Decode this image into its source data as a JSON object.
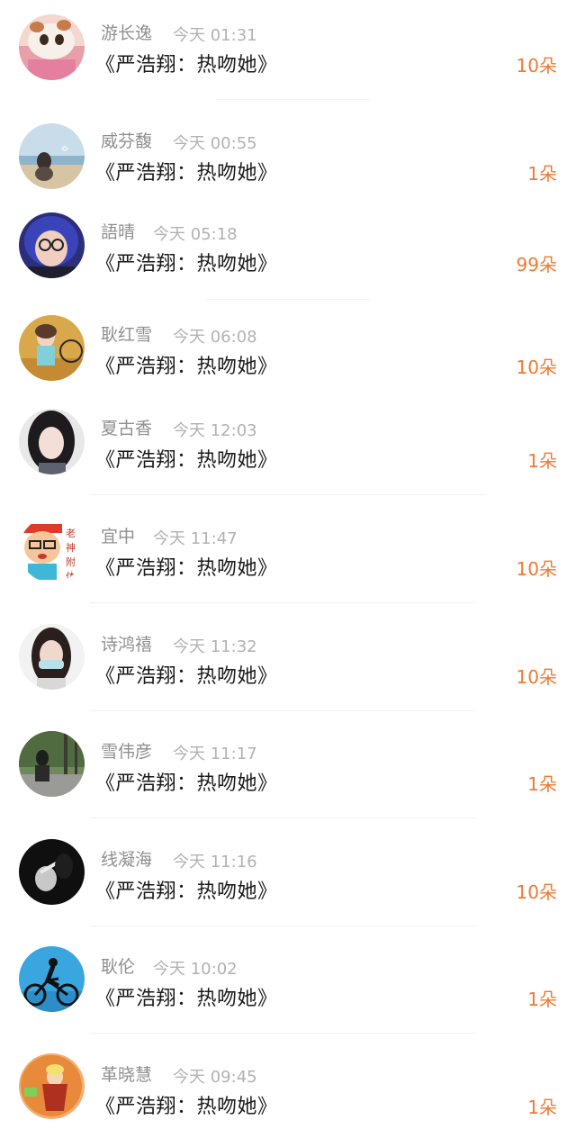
{
  "accent_color": "#f07a33",
  "items": [
    {
      "username": "游长逸",
      "time": "今天 01:31",
      "title": "《严浩翔：热吻她》",
      "count": "10朵",
      "avatar_icon": "cat-avatar-icon"
    },
    {
      "username": "威芬馥",
      "time": "今天 00:55",
      "title": "《严浩翔：热吻她》",
      "count": "1朵",
      "avatar_icon": "beach-avatar-icon"
    },
    {
      "username": "語晴",
      "time": "今天 05:18",
      "title": "《严浩翔：热吻她》",
      "count": "99朵",
      "avatar_icon": "glasses-girl-avatar-icon"
    },
    {
      "username": "耿红雪",
      "time": "今天 06:08",
      "title": "《严浩翔：热吻她》",
      "count": "10朵",
      "avatar_icon": "autumn-girl-avatar-icon"
    },
    {
      "username": "夏古香",
      "time": "今天 12:03",
      "title": "《严浩翔：热吻她》",
      "count": "1朵",
      "avatar_icon": "portrait-girl-avatar-icon"
    },
    {
      "username": "宜中",
      "time": "今天 11:47",
      "title": "《严浩翔：热吻她》",
      "count": "10朵",
      "avatar_icon": "cartoon-avatar-icon"
    },
    {
      "username": "诗鸿禧",
      "time": "今天 11:32",
      "title": "《严浩翔：热吻她》",
      "count": "10朵",
      "avatar_icon": "mask-girl-avatar-icon"
    },
    {
      "username": "雪伟彦",
      "time": "今天 11:17",
      "title": "《严浩翔：热吻她》",
      "count": "1朵",
      "avatar_icon": "forest-avatar-icon"
    },
    {
      "username": "线凝海",
      "time": "今天 11:16",
      "title": "《严浩翔：热吻她》",
      "count": "10朵",
      "avatar_icon": "dark-hand-avatar-icon"
    },
    {
      "username": "耿伦",
      "time": "今天 10:02",
      "title": "《严浩翔：热吻她》",
      "count": "1朵",
      "avatar_icon": "cyclist-avatar-icon"
    },
    {
      "username": "革晓慧",
      "time": "今天 09:45",
      "title": "《严浩翔：热吻她》",
      "count": "1朵",
      "avatar_icon": "game-character-avatar-icon"
    }
  ]
}
